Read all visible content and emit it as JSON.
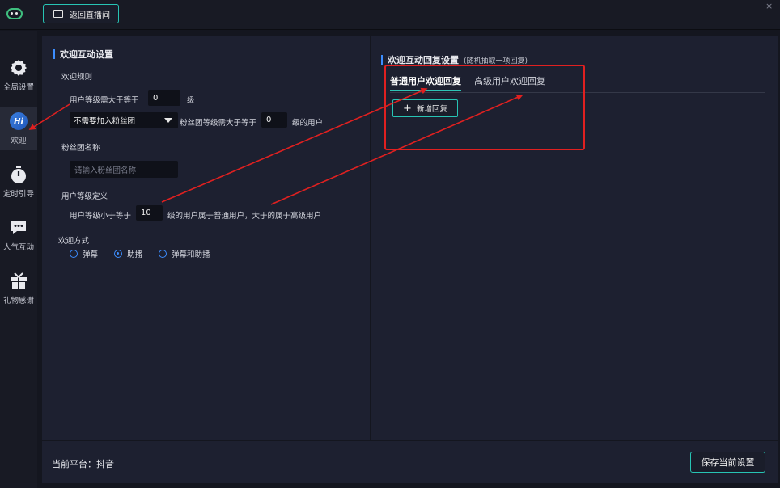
{
  "topbar": {
    "back_label": "返回直播间",
    "minimize": "−",
    "close": "×"
  },
  "sidebar": {
    "items": [
      {
        "label": "全局设置",
        "icon": "gear-icon"
      },
      {
        "label": "欢迎",
        "icon": "hi-icon",
        "icon_text": "Hi",
        "active": true
      },
      {
        "label": "定时引导",
        "icon": "timer-icon"
      },
      {
        "label": "人气互动",
        "icon": "chat-icon"
      },
      {
        "label": "礼物感谢",
        "icon": "gift-icon"
      }
    ]
  },
  "welcome": {
    "title": "欢迎互动设置",
    "rules_label": "欢迎规则",
    "level_prefix": "用户等级需大于等于",
    "level_value": "0",
    "level_suffix": "级",
    "fan_select": "不需要加入粉丝团",
    "fan_level_prefix": "粉丝团等级需大于等于",
    "fan_level_value": "0",
    "fan_level_suffix": "级的用户",
    "fan_name_label": "粉丝团名称",
    "fan_name_placeholder": "请输入粉丝团名称",
    "level_def_label": "用户等级定义",
    "level_def_prefix": "用户等级小于等于",
    "level_def_value": "10",
    "level_def_suffix": "级的用户属于普通用户，大于的属于高级用户",
    "mode_label": "欢迎方式",
    "modes": [
      {
        "label": "弹幕",
        "selected": false
      },
      {
        "label": "助播",
        "selected": true
      },
      {
        "label": "弹幕和助播",
        "selected": false
      }
    ]
  },
  "reply": {
    "title": "欢迎互动回复设置",
    "subtitle": "(随机抽取一项回复)",
    "tabs": [
      {
        "label": "普通用户欢迎回复",
        "active": true
      },
      {
        "label": "高级用户欢迎回复",
        "active": false
      }
    ],
    "add_label": "新增回复"
  },
  "bottom": {
    "platform": "当前平台：抖音",
    "save_label": "保存当前设置"
  },
  "colors": {
    "accent": "#27c4b4",
    "blue": "#3c8dff",
    "annotation": "#e02020"
  }
}
